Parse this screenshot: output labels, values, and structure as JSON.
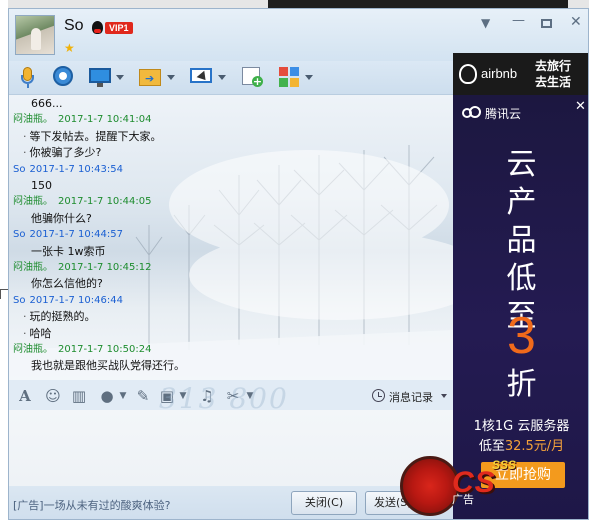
{
  "header": {
    "contact_name": "So",
    "vip_label": "VIP1"
  },
  "messages": [
    {
      "type": "text",
      "text": "666..."
    },
    {
      "type": "meta",
      "sender": "闷油瓶。",
      "time": "2017-1-7 10:41:04",
      "who": "other"
    },
    {
      "type": "text",
      "text": "等下发帖去。提醒下大家。",
      "bullet": true
    },
    {
      "type": "text",
      "text": "你被骗了多少?",
      "bullet": true
    },
    {
      "type": "meta",
      "sender": "So",
      "time": "2017-1-7 10:43:54",
      "who": "so"
    },
    {
      "type": "text",
      "text": "150"
    },
    {
      "type": "meta",
      "sender": "闷油瓶。",
      "time": "2017-1-7 10:44:05",
      "who": "other"
    },
    {
      "type": "text",
      "text": "他骗你什么?"
    },
    {
      "type": "meta",
      "sender": "So",
      "time": "2017-1-7 10:44:57",
      "who": "so"
    },
    {
      "type": "text",
      "text": "一张卡   1w索币"
    },
    {
      "type": "meta",
      "sender": "闷油瓶。",
      "time": "2017-1-7 10:45:12",
      "who": "other"
    },
    {
      "type": "text",
      "text": "你怎么信他的?"
    },
    {
      "type": "meta",
      "sender": "So",
      "time": "2017-1-7 10:46:44",
      "who": "so"
    },
    {
      "type": "text",
      "text": "玩的挺熟的。",
      "bullet": true
    },
    {
      "type": "text",
      "text": "哈哈",
      "bullet": true
    },
    {
      "type": "meta",
      "sender": "闷油瓶。",
      "time": "2017-1-7 10:50:24",
      "who": "other"
    },
    {
      "type": "text",
      "text": "我也就是跟他买战队党得还行。"
    }
  ],
  "input_toolbar": {
    "history_label": "消息记录"
  },
  "footer": {
    "ad_link": "[广告]一场从未有过的酸爽体验?",
    "close_label": "关闭(C)",
    "send_label": "发送(S)"
  },
  "ads": {
    "airbnb_name": "airbnb",
    "airbnb_slogan_1": "去旅行",
    "airbnb_slogan_2": "去生活",
    "tencent_brand": "腾讯云",
    "tencent_headline": [
      "云",
      "产",
      "品",
      "低",
      "至"
    ],
    "tencent_number": "3",
    "tencent_unit": "折",
    "tencent_spec": "1核1G 云服务器",
    "tencent_price_prefix": "低至",
    "tencent_price": "32.5元/月",
    "tencent_button": "立即抢购",
    "ad_label": "广告"
  },
  "overlay": {
    "watermark": "313 800"
  },
  "colors": {
    "sender_so": "#1a5fd2",
    "sender_other": "#1d8c2e",
    "ad_accent": "#f39a1d",
    "vip_badge": "#e0281c"
  }
}
